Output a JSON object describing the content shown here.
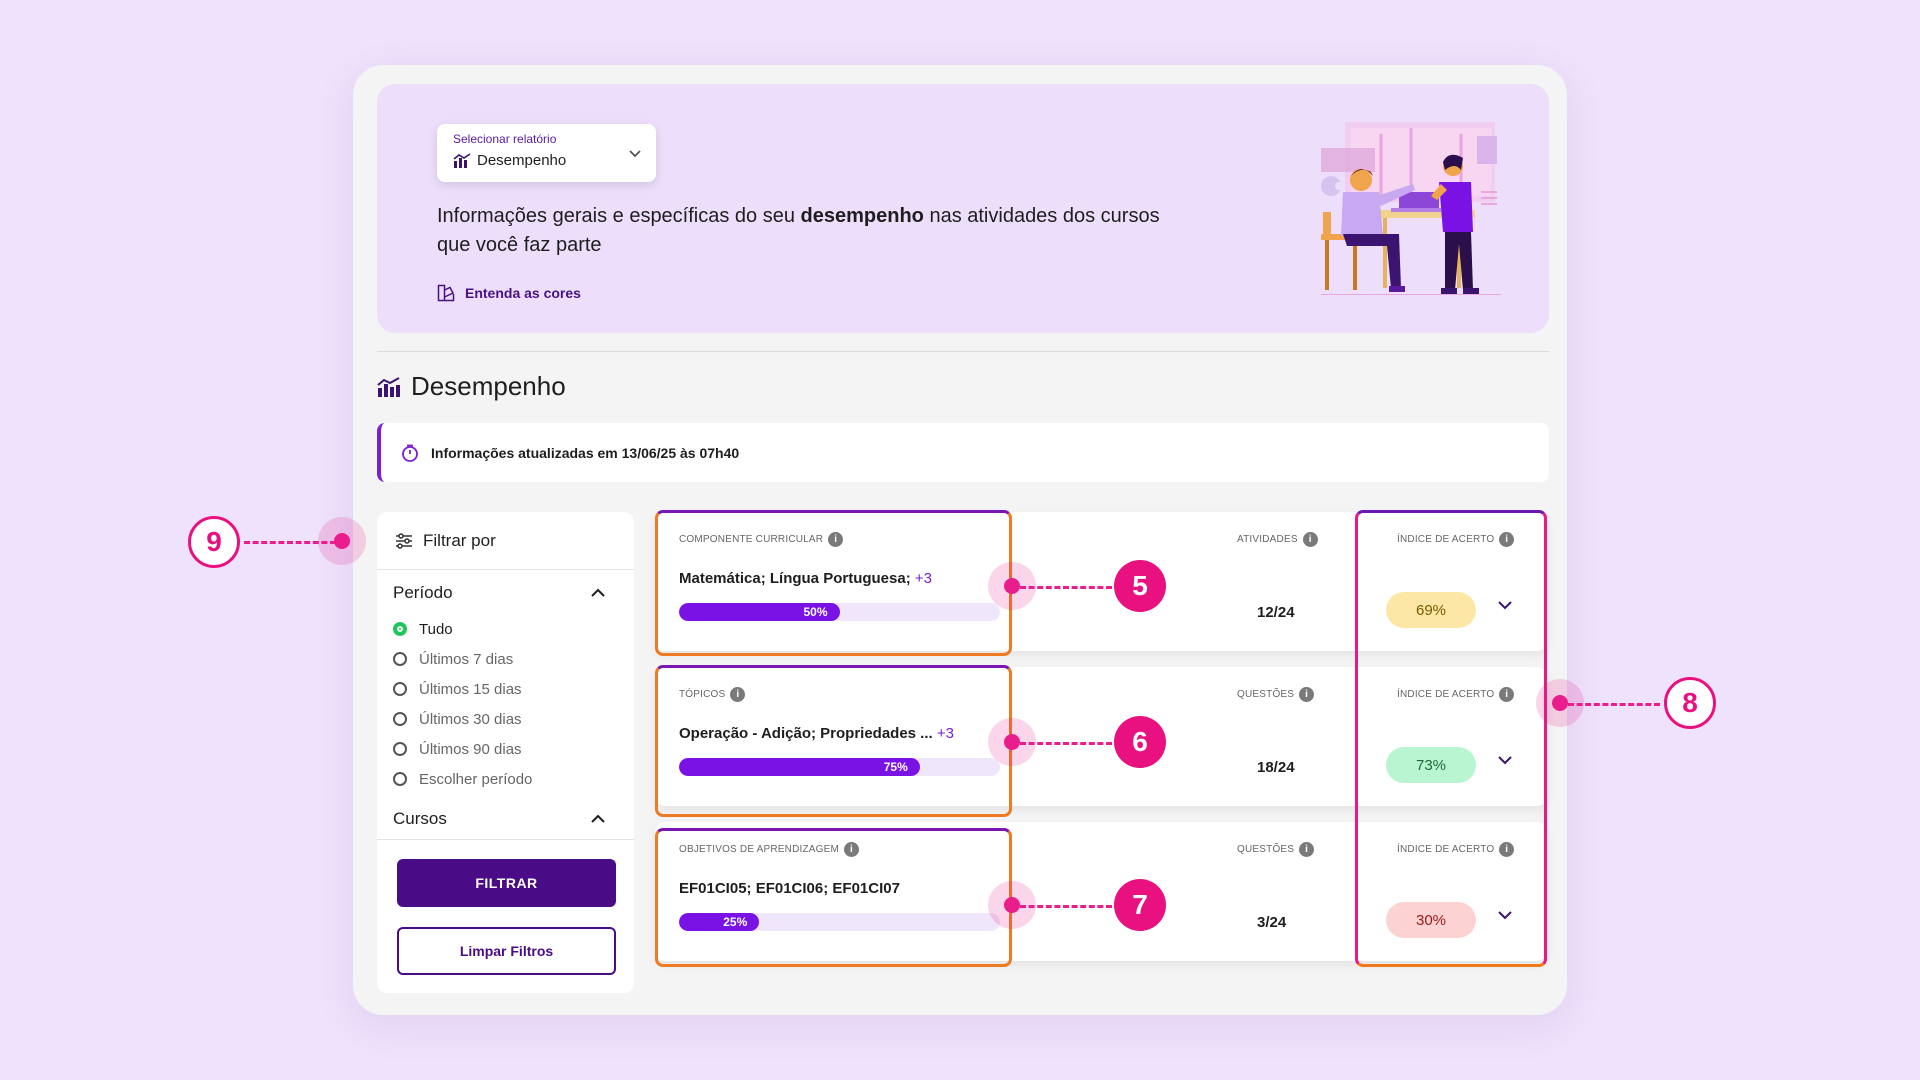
{
  "hero": {
    "select_caption": "Selecionar relatório",
    "select_value": "Desempenho",
    "description_pre": "Informações gerais e específicas do seu ",
    "description_bold": "desempenho",
    "description_post": " nas atividades dos cursos que você faz parte",
    "colors_link": "Entenda as cores"
  },
  "section": {
    "title": "Desempenho",
    "updated": "Informações atualizadas em 13/06/25 às 07h40"
  },
  "filter": {
    "title": "Filtrar por",
    "period_label": "Período",
    "period_options": [
      "Tudo",
      "Últimos 7 dias",
      "Últimos 15 dias",
      "Últimos 30 dias",
      "Últimos 90 dias",
      "Escolher período"
    ],
    "selected_index": 0,
    "courses_label": "Cursos",
    "filter_button": "FILTRAR",
    "clear_button": "Limpar Filtros"
  },
  "cards": [
    {
      "type_label": "COMPONENTE CURRICULAR",
      "main_text": "Matemática; Língua Portuguesa;",
      "more": "+3",
      "progress": 50,
      "progress_label": "50%",
      "count_label": "ATIVIDADES",
      "count_value": "12/24",
      "index_label": "ÍNDICE DE ACERTO",
      "index_value": "69%",
      "index_color": "#fde7a6",
      "index_text_color": "#7a5a00"
    },
    {
      "type_label": "TÓPICOS",
      "main_text": "Operação - Adição; Propriedades ...",
      "more": "+3",
      "progress": 75,
      "progress_label": "75%",
      "count_label": "QUESTÕES",
      "count_value": "18/24",
      "index_label": "ÍNDICE DE ACERTO",
      "index_value": "73%",
      "index_color": "#b9f5d0",
      "index_text_color": "#1c6b3d"
    },
    {
      "type_label": "OBJETIVOS DE APRENDIZAGEM",
      "main_text": "EF01CI05; EF01CI06; EF01CI07",
      "more": "",
      "progress": 25,
      "progress_label": "25%",
      "count_label": "QUESTÕES",
      "count_value": "3/24",
      "index_label": "ÍNDICE DE ACERTO",
      "index_value": "30%",
      "index_color": "#fdd2d2",
      "index_text_color": "#a01a1a"
    }
  ],
  "annotations": [
    "5",
    "6",
    "7",
    "8",
    "9"
  ],
  "colors": {
    "primary": "#4a0c86",
    "accent": "#7a12e6",
    "marker": "#e8117f",
    "success": "#23c55e"
  }
}
